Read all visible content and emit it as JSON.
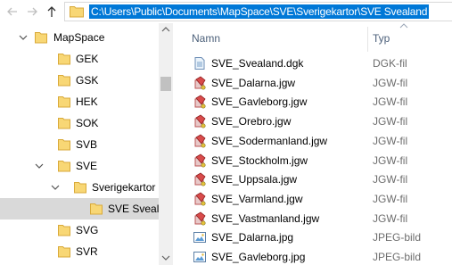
{
  "address_bar": {
    "path": "C:\\Users\\Public\\Documents\\MapSpace\\SVE\\Sverigekartor\\SVE Svealand"
  },
  "nav": {
    "back_icon": "arrow-left-icon",
    "forward_icon": "arrow-right-icon",
    "up_icon": "arrow-up-icon"
  },
  "tree": {
    "items": [
      {
        "label": "MapSpace",
        "level": 1,
        "expanded": true
      },
      {
        "label": "GEK",
        "level": 2,
        "expanded": false
      },
      {
        "label": "GSK",
        "level": 2,
        "expanded": false
      },
      {
        "label": "HEK",
        "level": 2,
        "expanded": false
      },
      {
        "label": "SOK",
        "level": 2,
        "expanded": false
      },
      {
        "label": "SVB",
        "level": 2,
        "expanded": false
      },
      {
        "label": "SVE",
        "level": 2,
        "expanded": true
      },
      {
        "label": "Sverigekartor",
        "level": 3,
        "expanded": true
      },
      {
        "label": "SVE Svealand",
        "level": 4,
        "selected": true
      },
      {
        "label": "SVG",
        "level": 2,
        "expanded": false
      },
      {
        "label": "SVR",
        "level": 2,
        "expanded": false
      }
    ]
  },
  "file_list": {
    "columns": {
      "name": "Namn",
      "type": "Typ"
    },
    "files": [
      {
        "name": "SVE_Svealand.dgk",
        "type": "DGK-fil",
        "icon": "text-document-icon"
      },
      {
        "name": "SVE_Dalarna.jgw",
        "type": "JGW-fil",
        "icon": "world-file-icon"
      },
      {
        "name": "SVE_Gavleborg.jgw",
        "type": "JGW-fil",
        "icon": "world-file-icon"
      },
      {
        "name": "SVE_Orebro.jgw",
        "type": "JGW-fil",
        "icon": "world-file-icon"
      },
      {
        "name": "SVE_Sodermanland.jgw",
        "type": "JGW-fil",
        "icon": "world-file-icon"
      },
      {
        "name": "SVE_Stockholm.jgw",
        "type": "JGW-fil",
        "icon": "world-file-icon"
      },
      {
        "name": "SVE_Uppsala.jgw",
        "type": "JGW-fil",
        "icon": "world-file-icon"
      },
      {
        "name": "SVE_Varmland.jgw",
        "type": "JGW-fil",
        "icon": "world-file-icon"
      },
      {
        "name": "SVE_Vastmanland.jgw",
        "type": "JGW-fil",
        "icon": "world-file-icon"
      },
      {
        "name": "SVE_Dalarna.jpg",
        "type": "JPEG-bild",
        "icon": "image-file-icon"
      },
      {
        "name": "SVE_Gavleborg.jpg",
        "type": "JPEG-bild",
        "icon": "image-file-icon"
      }
    ]
  },
  "colors": {
    "selection": "#0078d7",
    "tree_selected": "#d9d9d9",
    "folder": "#f8d775",
    "header_text": "#4c607a"
  }
}
